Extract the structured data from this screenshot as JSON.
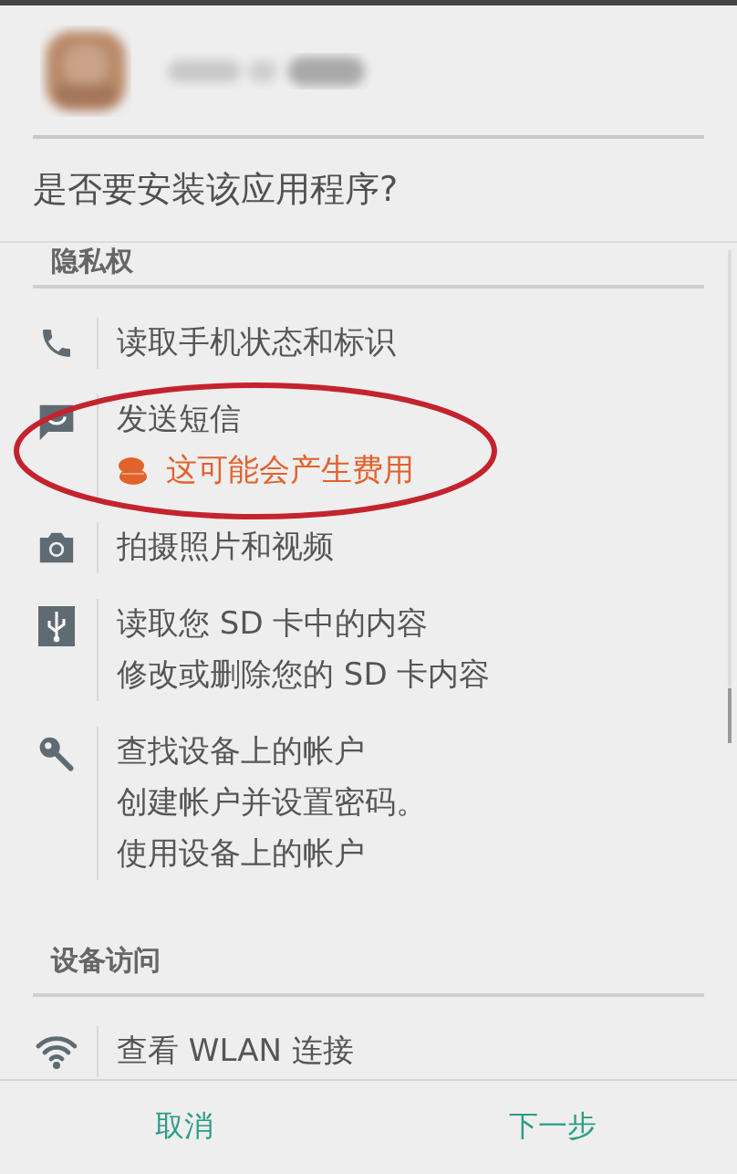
{
  "question": "是否要安装该应用程序?",
  "sections": [
    {
      "title": "隐私权",
      "items": [
        {
          "kind": "phone",
          "highlighted": false,
          "lines": [
            {
              "text": "读取手机状态和标识",
              "kind": "normal"
            }
          ]
        },
        {
          "kind": "message",
          "highlighted": true,
          "lines": [
            {
              "text": "发送短信",
              "kind": "normal"
            },
            {
              "text": "这可能会产生费用",
              "kind": "cost"
            }
          ]
        },
        {
          "kind": "camera",
          "highlighted": false,
          "lines": [
            {
              "text": "拍摄照片和视频",
              "kind": "normal"
            }
          ]
        },
        {
          "kind": "usb",
          "highlighted": false,
          "lines": [
            {
              "text": "读取您 SD 卡中的内容",
              "kind": "normal"
            },
            {
              "text": "修改或删除您的 SD 卡内容",
              "kind": "normal"
            }
          ]
        },
        {
          "kind": "key",
          "highlighted": false,
          "lines": [
            {
              "text": "查找设备上的帐户",
              "kind": "normal"
            },
            {
              "text": "创建帐户并设置密码。",
              "kind": "normal"
            },
            {
              "text": "使用设备上的帐户",
              "kind": "normal"
            }
          ]
        }
      ]
    },
    {
      "title": "设备访问",
      "items": [
        {
          "kind": "wifi",
          "highlighted": false,
          "lines": [
            {
              "text": "查看 WLAN 连接",
              "kind": "normal"
            }
          ]
        }
      ]
    }
  ],
  "buttons": [
    {
      "label": "取消"
    },
    {
      "label": "下一步"
    }
  ]
}
